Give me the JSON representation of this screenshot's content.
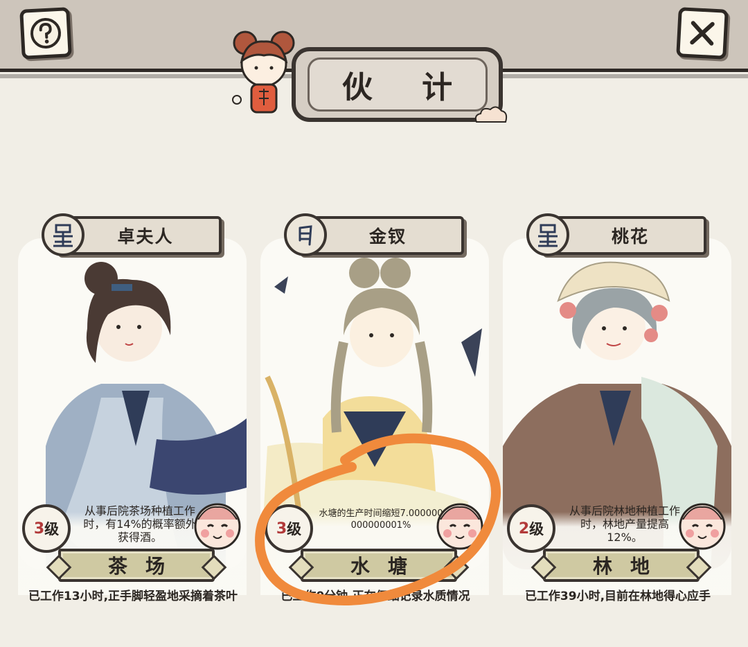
{
  "header": {
    "title": "伙 计",
    "help_icon": "question-mark-icon",
    "close_icon": "close-x-icon"
  },
  "cards": [
    {
      "name": "卓夫人",
      "rank_icon": "star-rank-icon",
      "level_number": "3",
      "level_unit": "级",
      "description": "从事后院茶场种植工作时，有14%的概率额外获得酒。",
      "location": "茶场",
      "status": "已工作13小时,正手脚轻盈地采摘着茶叶"
    },
    {
      "name": "金钗",
      "rank_icon": "moon-rank-icon",
      "level_number": "3",
      "level_unit": "级",
      "description": "水塘的生产时间缩短7.000000000000001%",
      "location": "水塘",
      "status": "已工作0分钟,正在仔细记录水质情况"
    },
    {
      "name": "桃花",
      "rank_icon": "star-rank-icon",
      "level_number": "2",
      "level_unit": "级",
      "description": "从事后院林地种植工作时，林地产量提高12%。",
      "location": "林地",
      "status": "已工作39小时,目前在林地得心应手"
    }
  ],
  "annotation": {
    "color": "#f08a3c",
    "shape": "hand-drawn-circle"
  },
  "colors": {
    "background": "#f1eee6",
    "header_bar": "#cdc5bb",
    "level_red": "#b23a3a",
    "location_plate": "#cfc9a2"
  }
}
